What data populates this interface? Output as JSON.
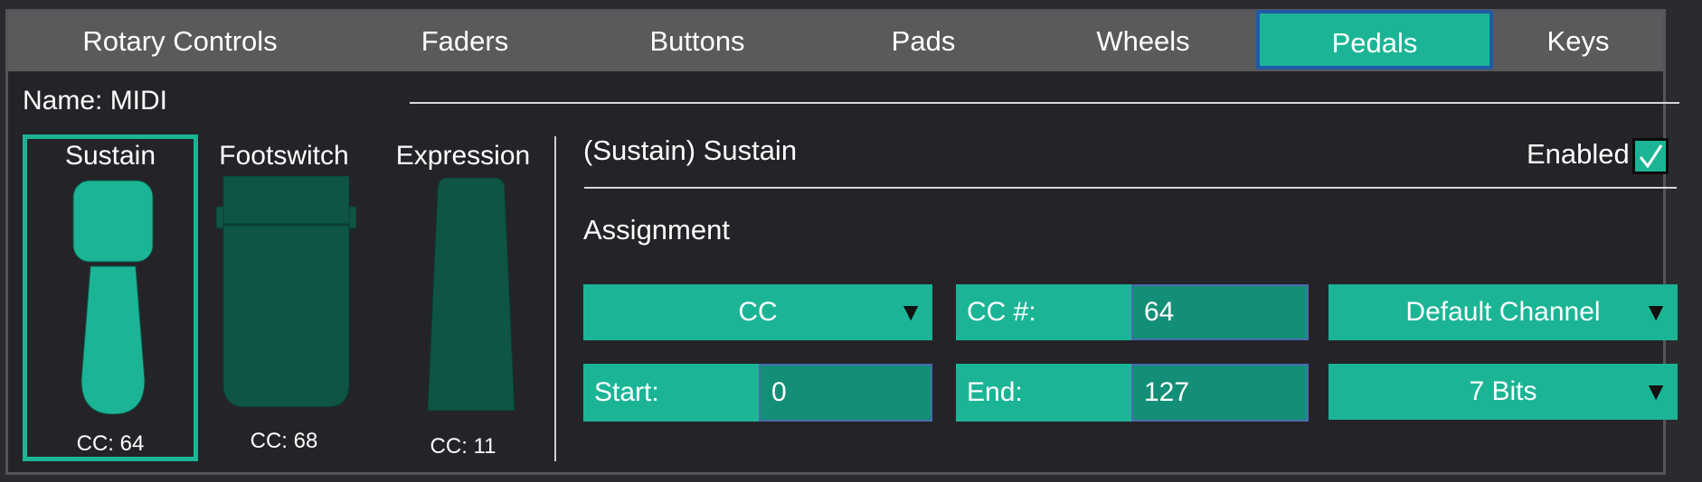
{
  "tabs": [
    {
      "label": "Rotary Controls",
      "active": false
    },
    {
      "label": "Faders",
      "active": false
    },
    {
      "label": "Buttons",
      "active": false
    },
    {
      "label": "Pads",
      "active": false
    },
    {
      "label": "Wheels",
      "active": false
    },
    {
      "label": "Pedals",
      "active": true
    },
    {
      "label": "Keys",
      "active": false
    }
  ],
  "name": {
    "label": "Name: MIDI"
  },
  "pedals": [
    {
      "name": "Sustain",
      "cc": "CC: 64",
      "selected": true
    },
    {
      "name": "Footswitch",
      "cc": "CC: 68",
      "selected": false
    },
    {
      "name": "Expression",
      "cc": "CC: 11",
      "selected": false
    }
  ],
  "detail": {
    "title": "(Sustain) Sustain",
    "enabled_label": "Enabled",
    "enabled": true,
    "assignment_label": "Assignment",
    "type_dropdown": "CC",
    "cc_number_label": "CC #:",
    "cc_number_value": "64",
    "channel_dropdown": "Default Channel",
    "start_label": "Start:",
    "start_value": "0",
    "end_label": "End:",
    "end_value": "127",
    "bits_dropdown": "7 Bits",
    "dropdown_arrow": "▼"
  },
  "colors": {
    "accent": "#1bb596",
    "accent_dark": "#0f5546",
    "field_bg": "#148f77",
    "tab_bar": "#5a5a5c",
    "active_tab_border": "#1f5aa6",
    "background": "#242428"
  },
  "icons": [
    "sustain-pedal-icon",
    "footswitch-pedal-icon",
    "expression-pedal-icon",
    "checkmark-icon",
    "dropdown-arrow-icon"
  ]
}
